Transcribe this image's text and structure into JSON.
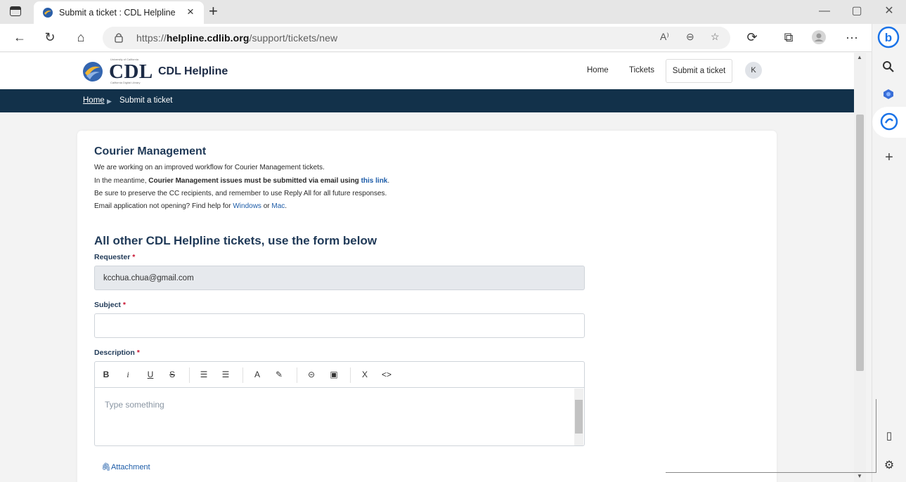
{
  "browser": {
    "tab_title": "Submit a ticket : CDL Helpline",
    "tab_close": "×",
    "new_tab": "+",
    "window_controls": {
      "minimize": "—",
      "maximize": "▢",
      "close": "✕"
    },
    "address": {
      "prefix": "https://",
      "domain": "helpline.cdlib.org",
      "path": "/support/tickets/new"
    },
    "icons": [
      "tab-actions-icon",
      "back-icon",
      "refresh-icon",
      "home-icon",
      "lock-icon",
      "read-aloud-icon",
      "zoom-icon",
      "favorites-icon",
      "extensions-icon",
      "collections-icon",
      "profile-icon",
      "more-icon",
      "bing-icon"
    ],
    "toolbar_glyphs": {
      "back": "←",
      "refresh": "↻",
      "home": "⌂",
      "read_aloud": "A⁾",
      "zoom": "⊖",
      "favorites": "☆",
      "extensions": "⟳",
      "collections": "⧉",
      "more": "···"
    },
    "sidebar_glyphs": {
      "search": "🔍",
      "add": "+",
      "panel": "▯",
      "settings": "⚙"
    }
  },
  "site": {
    "logo_text": "CDL",
    "logo_name": "CDL Helpline",
    "logo_uc": "University of California",
    "logo_sub": "California Digital Library",
    "nav": {
      "home": "Home",
      "tickets": "Tickets",
      "submit": "Submit a ticket",
      "avatar_initial": "K"
    },
    "breadcrumb": {
      "home": "Home",
      "separator": "▶",
      "current": "Submit a ticket"
    }
  },
  "notice": {
    "heading": "Courier Management",
    "line1": "We are working on an improved workflow for Courier Management tickets.",
    "line2_prefix": "In the meantime, ",
    "line2_bold": "Courier Management issues must be submitted via email using ",
    "line2_link": "this link",
    "line2_end": ".",
    "line3": "Be sure to preserve the CC recipients, and remember to use Reply All for all future responses.",
    "line4_prefix": "Email application not opening? Find help for ",
    "line4_link1": "Windows",
    "line4_or": " or ",
    "line4_link2": "Mac",
    "line4_end": "."
  },
  "form": {
    "heading": "All other CDL Helpline tickets, use the form below",
    "requester_label": "Requester",
    "requester_value": "kcchua.chua@gmail.com",
    "subject_label": "Subject",
    "subject_value": "",
    "description_label": "Description",
    "required_mark": "*",
    "editor_placeholder": "Type something",
    "editor_tools": {
      "bold": "B",
      "italic": "i",
      "underline": "U",
      "strike": "S",
      "ordered": "☰",
      "bullet": "☰",
      "color": "A",
      "highlight": "✎",
      "link": "⊝",
      "image": "▣",
      "clear": "X",
      "code": "<>"
    },
    "attachment": "Attachment"
  },
  "colors": {
    "navy": "#12314a",
    "heading": "#1f3957",
    "link": "#1d5ca8",
    "required": "#c8102e"
  }
}
